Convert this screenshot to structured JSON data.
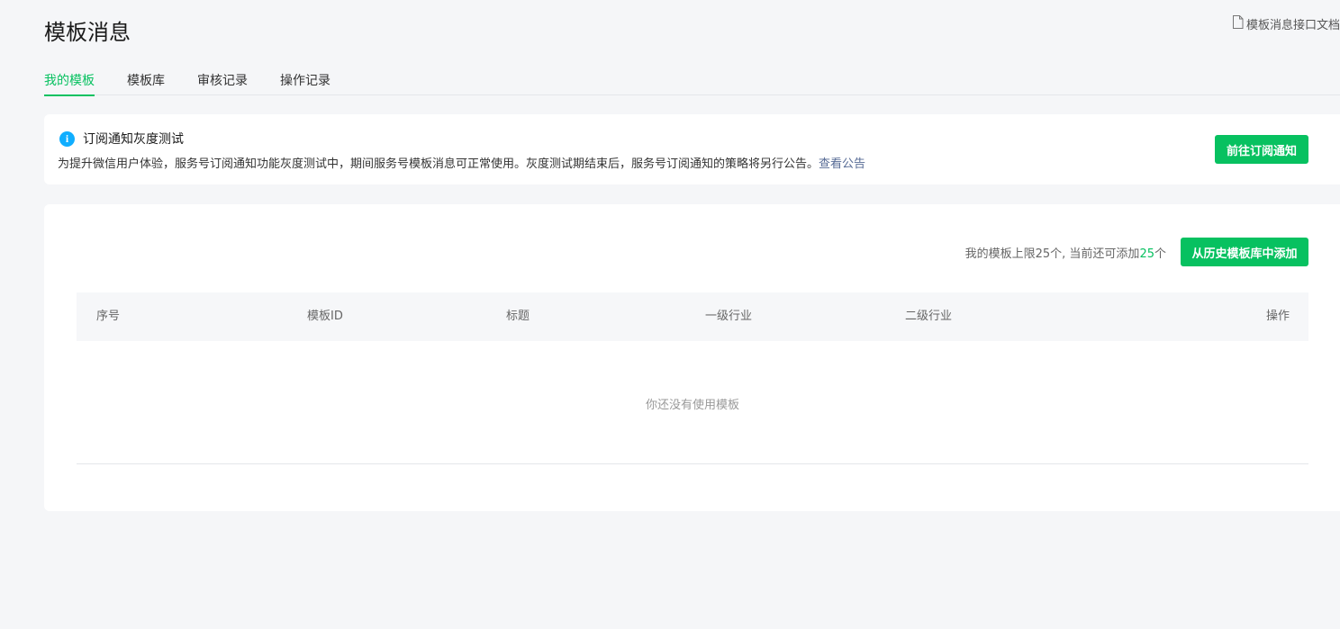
{
  "header": {
    "title": "模板消息",
    "doc_link": "模板消息接口文档"
  },
  "tabs": [
    {
      "label": "我的模板",
      "active": true
    },
    {
      "label": "模板库",
      "active": false
    },
    {
      "label": "审核记录",
      "active": false
    },
    {
      "label": "操作记录",
      "active": false
    }
  ],
  "notice": {
    "icon": "info-icon",
    "icon_glyph": "i",
    "title": "订阅通知灰度测试",
    "description": "为提升微信用户体验，服务号订阅通知功能灰度测试中，期间服务号模板消息可正常使用。灰度测试期结束后，服务号订阅通知的策略将另行公告。",
    "link": "查看公告",
    "button": "前往订阅通知"
  },
  "templates": {
    "quota_prefix": "我的模板上限25个, 当前还可添加",
    "quota_remaining": "25",
    "quota_suffix": "个",
    "add_button": "从历史模板库中添加",
    "columns": [
      "序号",
      "模板ID",
      "标题",
      "一级行业",
      "二级行业",
      "操作"
    ],
    "rows": [],
    "empty_text": "你还没有使用模板"
  },
  "colors": {
    "accent": "#07c160",
    "info": "#10aeff",
    "link": "#576b95",
    "background": "#f5f6f8"
  }
}
